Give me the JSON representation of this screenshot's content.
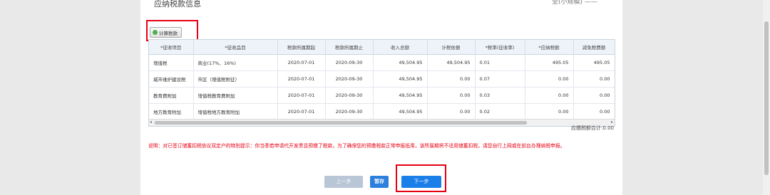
{
  "header": {
    "title": "应纳税款信息",
    "top_right_partial": "业(小规模) ——"
  },
  "toolbar": {
    "calc_label": "计算税款"
  },
  "table": {
    "columns": [
      "*征收项目",
      "*征收品目",
      "税款所属期起",
      "税款所属期止",
      "收入总额",
      "计税依据",
      "*税率(征收率)",
      "*应纳税额",
      "减免税费额"
    ],
    "rows": [
      [
        "增值税",
        "商业(17%、16%)",
        "2020-07-01",
        "2020-09-30",
        "49,504.95",
        "49,504.95",
        "0.01",
        "495.05",
        "495.05"
      ],
      [
        "城市维护建设税",
        "市区（增值税附征）",
        "2020-07-01",
        "2020-09-30",
        "49,504.95",
        "0.00",
        "0.07",
        "0.00",
        "0.00"
      ],
      [
        "教育费附加",
        "增值税教育费附加",
        "2020-07-01",
        "2020-09-30",
        "49,504.95",
        "0.00",
        "0.03",
        "0.00",
        "0.00"
      ],
      [
        "地方教育附加",
        "增值税地方教育附加",
        "2020-07-01",
        "2020-09-30",
        "49,504.95",
        "0.00",
        "0.02",
        "0.00",
        "0.00"
      ]
    ]
  },
  "summary": {
    "total_label": "应缴税额合计:0.00"
  },
  "notice": {
    "text": "说明：对已签订储蓄扣税协议双定户的特别提示：你当季若申请代开发票且预缴了税款，为了确保您的预缴税款正常申报抵用，该所属期将不适用储蓄扣税，请您自行上网或在前台办理纳税申报。"
  },
  "footer": {
    "prev_label": "上一步",
    "save_label": "暂存",
    "next_label": "下一步"
  }
}
